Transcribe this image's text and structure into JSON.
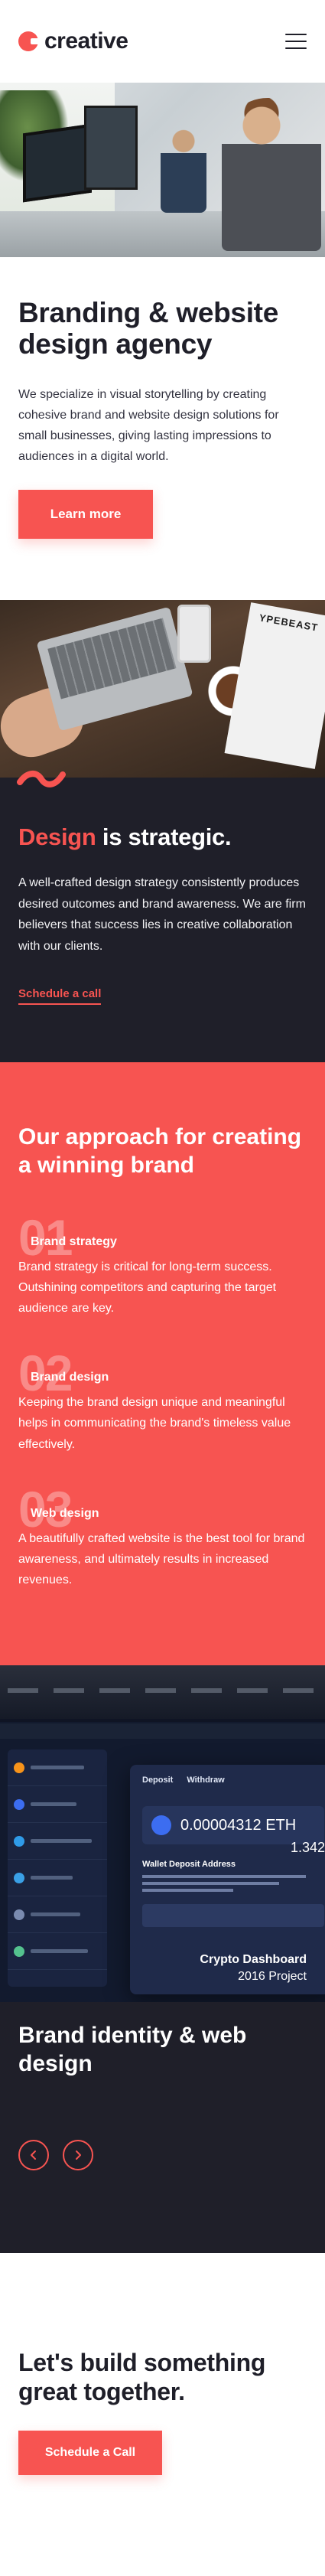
{
  "brand": {
    "name": "creative",
    "accent": "#f75451",
    "dark": "#1f1f29"
  },
  "header": {
    "menu_icon": "hamburger-icon"
  },
  "intro": {
    "title": "Branding & website design agency",
    "body": "We specialize in visual storytelling by creating cohesive brand and website design solutions for small businesses, giving lasting impressions to audiences in a digital world.",
    "button": "Learn more"
  },
  "strategy": {
    "title_accent": "Design",
    "title_rest": " is strategic.",
    "body": "A well-crafted design strategy consistently produces desired outcomes and brand awareness. We are firm believers that success lies in creative collaboration with our clients.",
    "link": "Schedule a call"
  },
  "approach": {
    "title": "Our approach for creating a winning brand",
    "steps": [
      {
        "num": "01",
        "title": "Brand strategy",
        "body": "Brand strategy is critical for long-term success. Outshining competitors and capturing the target audience are key."
      },
      {
        "num": "02",
        "title": "Brand design",
        "body": "Keeping the brand design unique and meaningful helps in communicating the brand's timeless value effectively."
      },
      {
        "num": "03",
        "title": "Web design",
        "body": "A beautifully crafted website is the best tool for brand awareness, and ultimately results in increased revenues."
      }
    ]
  },
  "project": {
    "screen_tabs": [
      "Deposit",
      "Withdraw"
    ],
    "screen_amount": "0.00004312 ETH",
    "screen_side_amount": "1.342",
    "screen_wallet_title": "Wallet Deposit Address",
    "name": "Crypto Dashboard",
    "year": "2016 Project"
  },
  "projects": {
    "title": "Brand identity & web design",
    "prev_icon": "chevron-left-icon",
    "next_icon": "chevron-right-icon"
  },
  "cta": {
    "title": "Let's build something great together.",
    "button": "Schedule a Call"
  }
}
